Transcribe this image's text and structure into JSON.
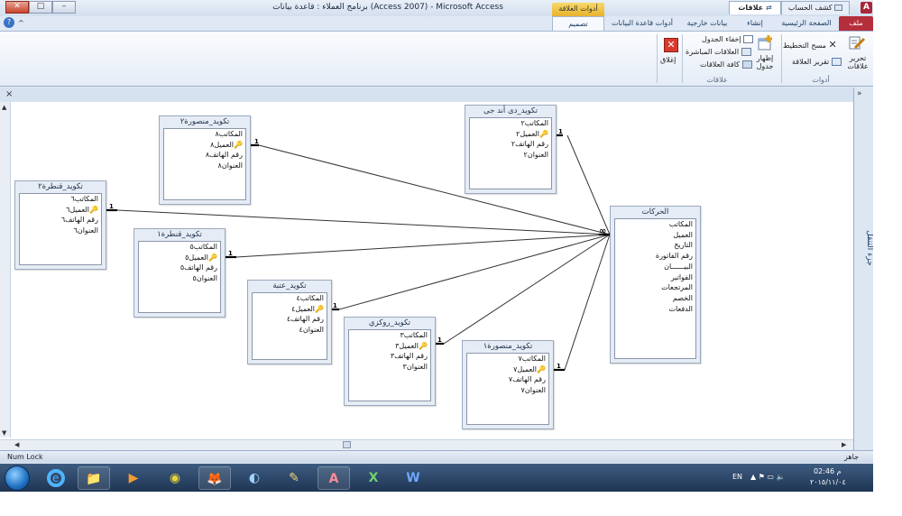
{
  "window": {
    "title": "برنامج العملاء : قاعدة بيانات (Access 2007) - Microsoft Access",
    "context_tab": "أدوات العلاقة",
    "app_icon": "A",
    "min": "–",
    "max": "□",
    "close": "✕"
  },
  "quick_access": {
    "items": [
      "▾",
      "↶",
      "↷",
      "💾"
    ]
  },
  "ribbon": {
    "tabs": {
      "file": "ملف",
      "home": "الصفحة الرئيسية",
      "create": "إنشاء",
      "external": "بيانات خارجية",
      "dbtools": "أدوات قاعدة البيانات",
      "design": "تصميم"
    },
    "tools_group": {
      "label": "أدوات",
      "edit_relationships": "تحرير\nعلاقات",
      "clear_layout": "مسح التخطيط",
      "relationship_report": "تقرير العلاقة"
    },
    "relationships_group": {
      "label": "علاقات",
      "show_table": "إظهار\nجدول",
      "hide_table": "إخفاء الجدول",
      "direct_relationships": "العلاقات المباشرة",
      "all_relationships": "كافة العلاقات",
      "close": "إغلاق"
    },
    "help": "?",
    "caret": "^"
  },
  "nav_pane": {
    "label": "جزء التنقل",
    "toggle": "»"
  },
  "doc_tabs": [
    {
      "label": "كشف الحساب",
      "active": false
    },
    {
      "label": "علاقات",
      "active": true
    }
  ],
  "doc_close": "×",
  "tables": [
    {
      "id": "mansoura2",
      "title": "تكويد_منصورة٢",
      "fields": [
        "المكاتب٨",
        "العميل٨",
        "رقم الهاتف٨",
        "العنوان٨"
      ],
      "key_index": 1
    },
    {
      "id": "dd",
      "title": "تكويد_دى أند جى",
      "fields": [
        "المكاتب٢",
        "العميل٢",
        "رقم الهاتف٢",
        "العنوان٢"
      ],
      "key_index": 1
    },
    {
      "id": "qantara2",
      "title": "تكويد_قنطرة٢",
      "fields": [
        "المكاتب٦",
        "العميل٦",
        "رقم الهاتف٦",
        "العنوان٦"
      ],
      "key_index": 1
    },
    {
      "id": "qantara1",
      "title": "تكويد_قنطرة١",
      "fields": [
        "المكاتب٥",
        "العميل٥",
        "رقم الهاتف٥",
        "العنوان٥"
      ],
      "key_index": 1
    },
    {
      "id": "ataba",
      "title": "تكويد_عتبة",
      "fields": [
        "المكاتب٤",
        "العميل٤",
        "رقم الهاتف٤",
        "العنوان٤"
      ],
      "key_index": 1
    },
    {
      "id": "roxy",
      "title": "تكويد_روكزي",
      "fields": [
        "المكاتب٣",
        "العميل٣",
        "رقم الهاتف٣",
        "العنوان٣"
      ],
      "key_index": 1
    },
    {
      "id": "mansoura1",
      "title": "تكويد_منصورة١",
      "fields": [
        "المكاتب٧",
        "العميل٧",
        "رقم الهاتف٧",
        "العنوان٧"
      ],
      "key_index": 1
    },
    {
      "id": "movements",
      "title": "الحركات",
      "fields": [
        "المكاتب",
        "العميل",
        "التاريخ",
        "رقم الفاتورة",
        "البيــــــان",
        "الفواتير",
        "المرتجعات",
        "الخصم",
        "الدفعات"
      ],
      "key_index": -1
    }
  ],
  "relationship": {
    "one_label": "1",
    "many_label": "∞"
  },
  "status_bar": {
    "left": "Num Lock",
    "right": "جاهز"
  },
  "taskbar": {
    "apps": [
      "📁",
      "▶",
      "◉",
      "🦊",
      "◐",
      "✎",
      "A",
      "X",
      "W"
    ],
    "tray_lang": "EN",
    "tray_icons": "▲  ⚑  ▭  🔈",
    "time": "02:46 م",
    "date": "٢٠١٥/١١/٠٤"
  },
  "colors": {
    "file_tab": "#b52e3c",
    "context_tab": "#e8b22c",
    "taskbar": "#1f3554"
  }
}
